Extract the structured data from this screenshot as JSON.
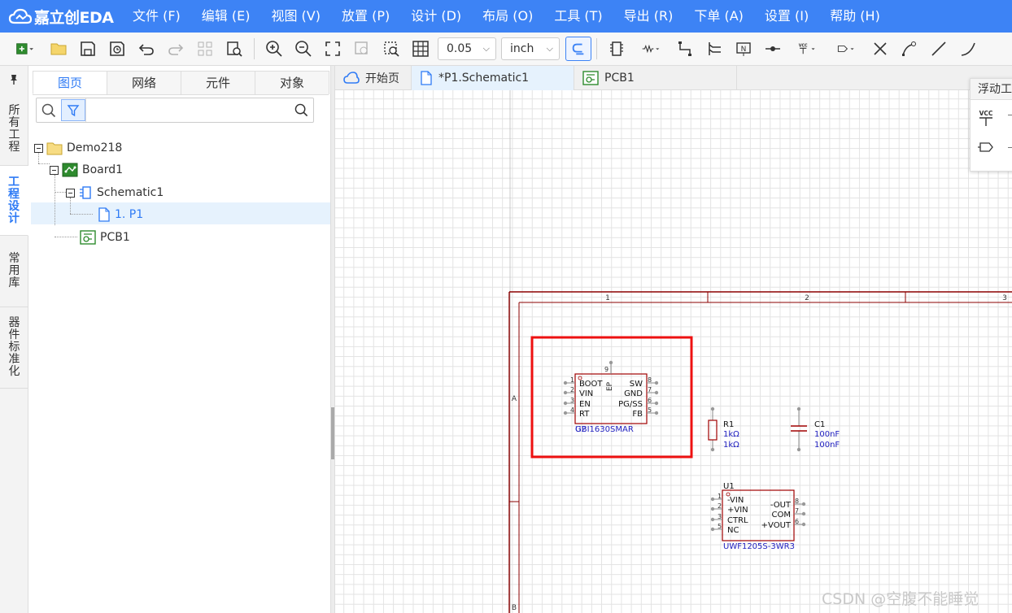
{
  "app": {
    "logo_text": "嘉立创EDA",
    "menu": [
      "文件 (F)",
      "编辑 (E)",
      "视图 (V)",
      "放置 (P)",
      "设计 (D)",
      "布局 (O)",
      "工具 (T)",
      "导出 (R)",
      "下单 (A)",
      "设置 (I)",
      "帮助 (H)"
    ]
  },
  "toolbar": {
    "grid_value": "0.05",
    "unit_value": "inch",
    "vcc_label": "VCC"
  },
  "side_tabs": [
    "所有工程",
    "工程设计",
    "常用库",
    "器件标准化"
  ],
  "panel": {
    "tabs": [
      "图页",
      "网络",
      "元件",
      "对象"
    ],
    "search_placeholder": ""
  },
  "tree": {
    "project": "Demo218",
    "board": "Board1",
    "schematic": "Schematic1",
    "page": "1. P1",
    "pcb": "PCB1"
  },
  "doc_tabs": [
    "开始页",
    "*P1.Schematic1",
    "PCB1"
  ],
  "float_toolbar": {
    "title": "浮动工具",
    "vcc_label": "VCC"
  },
  "schematic": {
    "frame_cols": [
      "1",
      "2",
      "3"
    ],
    "frame_rows": [
      "A",
      "B"
    ],
    "u2": {
      "designator": "U2",
      "part": "GBI1630SMAR",
      "ep_label": "EP",
      "ep_pin": "9",
      "left_pins": [
        "BOOT",
        "VIN",
        "EN",
        "RT"
      ],
      "left_nums": [
        "1",
        "2",
        "3",
        "4"
      ],
      "right_pins": [
        "SW",
        "GND",
        "PG/SS",
        "FB"
      ],
      "right_nums": [
        "8",
        "7",
        "6",
        "5"
      ]
    },
    "r1": {
      "designator": "R1",
      "value": "1kΩ",
      "value2": "1kΩ"
    },
    "c1": {
      "designator": "C1",
      "value": "100nF",
      "value2": "100nF"
    },
    "u1": {
      "designator": "U1",
      "part": "UWF1205S-3WR3",
      "left_pins": [
        "-VIN",
        "+VIN",
        "CTRL",
        "NC"
      ],
      "left_nums": [
        "1",
        "2",
        "3",
        "5"
      ],
      "right_pins": [
        "-OUT",
        "COM",
        "+VOUT"
      ],
      "right_nums": [
        "8",
        "7",
        "6"
      ]
    }
  },
  "watermark": "CSDN @空腹不能睡觉",
  "colors": {
    "accent": "#3d83f5",
    "frame": "#8b0000",
    "component_body": "#a00000",
    "pin_dot": "#888888",
    "highlight_box": "#ee1111",
    "part_name": "#2020c0"
  }
}
